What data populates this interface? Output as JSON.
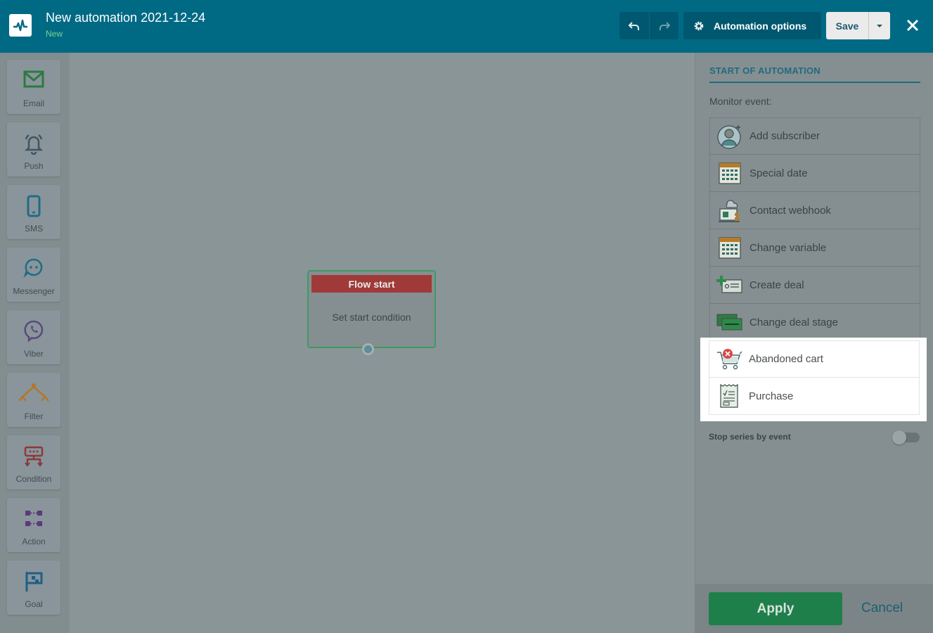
{
  "header": {
    "title": "New automation 2021-12-24",
    "status": "New",
    "options_label": "Automation options",
    "save_label": "Save"
  },
  "tools": [
    {
      "label": "Email",
      "icon": "envelope-icon"
    },
    {
      "label": "Push",
      "icon": "bell-icon"
    },
    {
      "label": "SMS",
      "icon": "phone-icon"
    },
    {
      "label": "Messenger",
      "icon": "chat-icon"
    },
    {
      "label": "Viber",
      "icon": "viber-icon"
    },
    {
      "label": "Filter",
      "icon": "filter-icon"
    },
    {
      "label": "Condition",
      "icon": "condition-icon"
    },
    {
      "label": "Action",
      "icon": "action-icon"
    },
    {
      "label": "Goal",
      "icon": "flag-icon"
    }
  ],
  "canvas": {
    "node_title": "Flow start",
    "node_body": "Set start condition"
  },
  "panel": {
    "title": "START OF AUTOMATION",
    "monitor_label": "Monitor event:",
    "events": [
      {
        "label": "Add subscriber",
        "icon": "add-subscriber-icon"
      },
      {
        "label": "Special date",
        "icon": "calendar-icon"
      },
      {
        "label": "Contact webhook",
        "icon": "webhook-icon"
      },
      {
        "label": "Change variable",
        "icon": "calendar-icon"
      },
      {
        "label": "Create deal",
        "icon": "create-deal-icon"
      },
      {
        "label": "Change deal stage",
        "icon": "deal-stage-icon"
      },
      {
        "label": "Abandoned cart",
        "icon": "abandoned-cart-icon"
      },
      {
        "label": "Purchase",
        "icon": "receipt-icon"
      }
    ],
    "stop_label": "Stop series by event",
    "apply_label": "Apply",
    "cancel_label": "Cancel"
  },
  "colors": {
    "header_bg": "#006a85",
    "apply": "#1f7f4b",
    "flow_start": "#a03a38",
    "accent": "#1f6b80"
  }
}
